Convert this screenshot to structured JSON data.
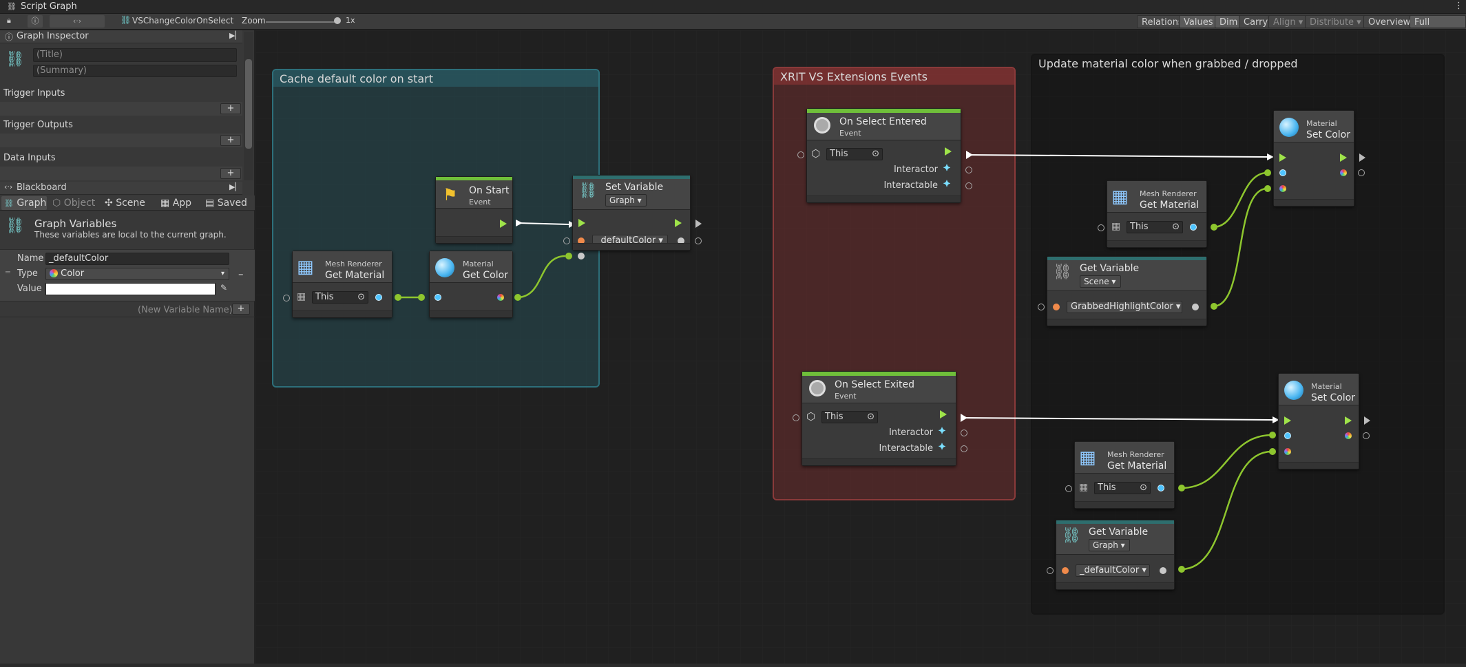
{
  "window": {
    "title": "Script Graph"
  },
  "toolbar": {
    "graph_name": "VSChangeColorOnSelect",
    "zoom_label": "Zoom",
    "zoom_value": "1x",
    "buttons": [
      "Relations",
      "Values",
      "Dim",
      "Carry",
      "Align",
      "Distribute",
      "Overview",
      "Full Screen"
    ]
  },
  "inspector": {
    "header": "Graph Inspector",
    "title_placeholder": "(Title)",
    "summary_placeholder": "(Summary)",
    "sections": [
      "Trigger Inputs",
      "Trigger Outputs",
      "Data Inputs"
    ],
    "plus": "+"
  },
  "blackboard": {
    "header": "Blackboard",
    "tabs": [
      "Graph",
      "Object",
      "Scene",
      "App",
      "Saved"
    ],
    "vars_title": "Graph Variables",
    "vars_desc": "These variables are local to the current graph.",
    "name_label": "Name",
    "name_value": "_defaultColor",
    "type_label": "Type",
    "type_value": "Color",
    "value_label": "Value",
    "new_var_placeholder": "(New Variable Name)",
    "minus": "–"
  },
  "groups": {
    "g1": "Cache default color on start",
    "g2": "XRIT VS Extensions Events",
    "g3": "Update material color when grabbed / dropped"
  },
  "nodes": {
    "onstart": {
      "title": "On Start",
      "sub": "Event"
    },
    "setvar": {
      "title": "Set Variable",
      "kind": "Graph",
      "var": "_defaultColor"
    },
    "getmat1": {
      "sub": "Mesh Renderer",
      "title": "Get Material",
      "target": "This"
    },
    "getcolor": {
      "sub": "Material",
      "title": "Get Color"
    },
    "selEntered": {
      "title": "On Select Entered",
      "sub": "Event",
      "target": "This",
      "p1": "Interactor",
      "p2": "Interactable"
    },
    "selExited": {
      "title": "On Select Exited",
      "sub": "Event",
      "target": "This",
      "p1": "Interactor",
      "p2": "Interactable"
    },
    "setcolor1": {
      "sub": "Material",
      "title": "Set Color"
    },
    "setcolor2": {
      "sub": "Material",
      "title": "Set Color"
    },
    "getmat2": {
      "sub": "Mesh Renderer",
      "title": "Get Material",
      "target": "This"
    },
    "getmat3": {
      "sub": "Mesh Renderer",
      "title": "Get Material",
      "target": "This"
    },
    "getvar1": {
      "title": "Get Variable",
      "kind": "Scene",
      "var": "GrabbedHighlightColor"
    },
    "getvar2": {
      "title": "Get Variable",
      "kind": "Graph",
      "var": "_defaultColor"
    }
  },
  "colors": {
    "flow_green": "#9fe34a",
    "event_header": "#6fbf3a",
    "variable_header": "#2e6e6e",
    "group_cyan": "#1d3a3f",
    "group_red": "#4a2828",
    "group_dark": "#1a1a1a"
  }
}
